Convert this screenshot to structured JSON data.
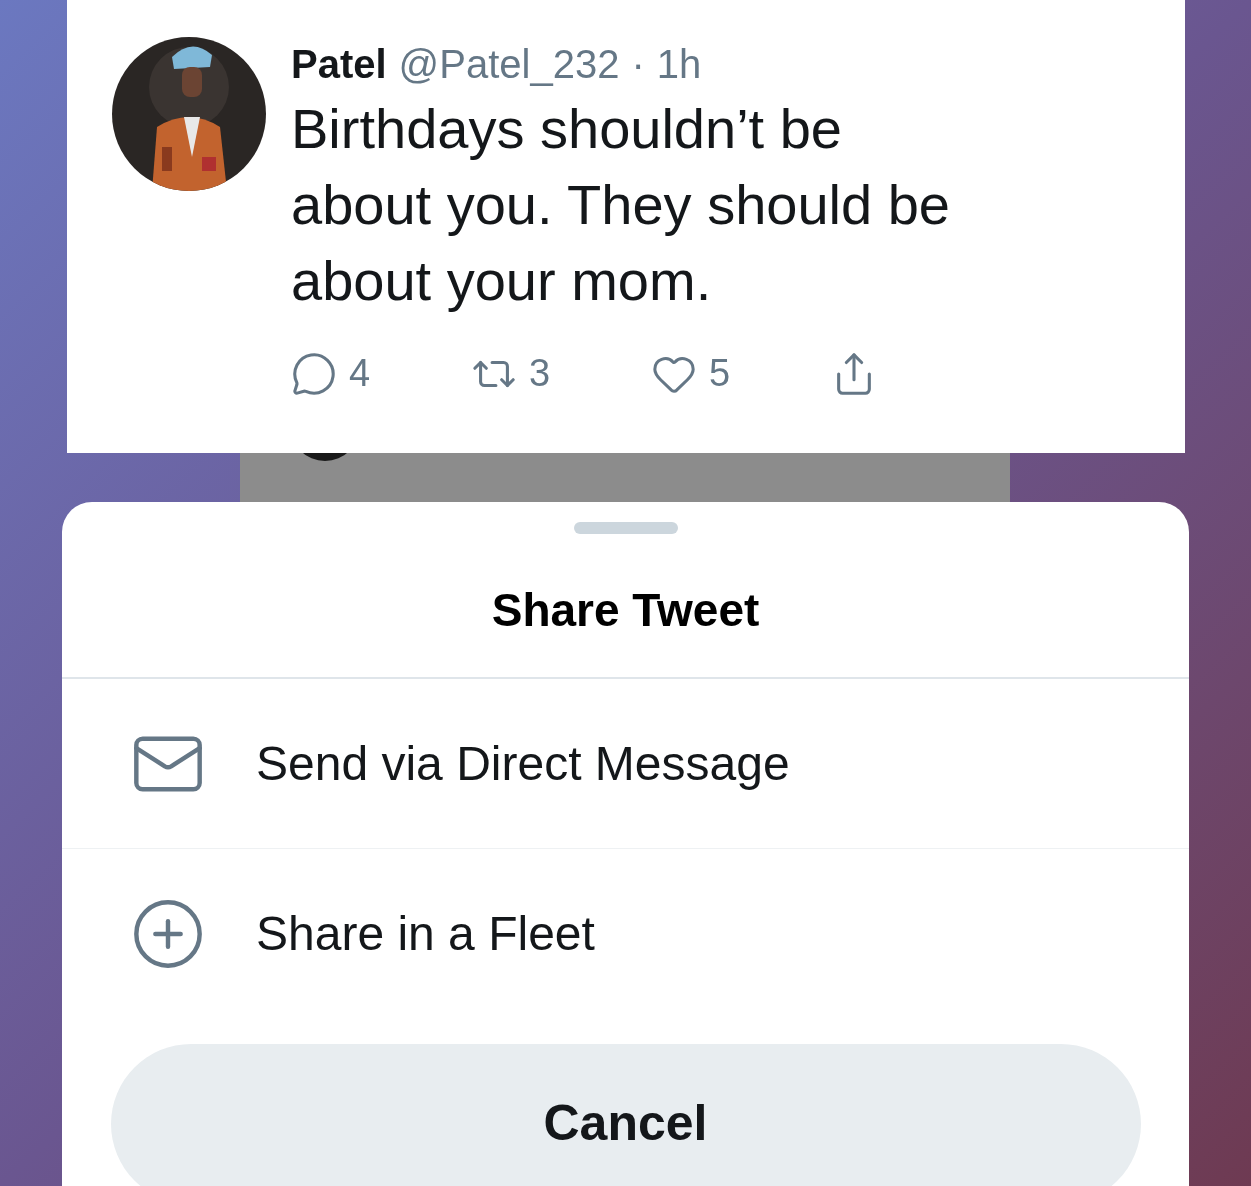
{
  "tweet": {
    "name": "Patel",
    "handle": "@Patel_232",
    "separator": "·",
    "time": "1h",
    "text": "Birthdays shouldn’t be about you. They should be about your mom.",
    "actions": [
      {
        "kind": "reply",
        "count": "4"
      },
      {
        "kind": "retweet",
        "count": "3"
      },
      {
        "kind": "like",
        "count": "5"
      },
      {
        "kind": "share"
      }
    ]
  },
  "share_sheet": {
    "title": "Share Tweet",
    "options": [
      {
        "kind": "message",
        "label": "Send via Direct Message"
      },
      {
        "kind": "fleet",
        "label": "Share in a Fleet"
      }
    ],
    "cancel": "Cancel"
  }
}
